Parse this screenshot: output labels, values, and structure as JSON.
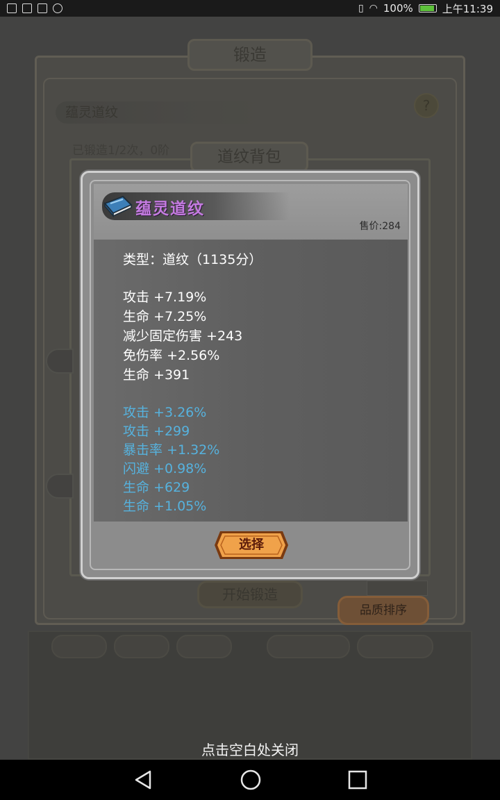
{
  "status_bar": {
    "battery": "100%",
    "battery_level": 1.0,
    "time": "上午11:39"
  },
  "background": {
    "title": "锻造",
    "item_name": "蕴灵道纹",
    "help": "?",
    "forge_count": "已锻造1/2次，0阶",
    "bag_title": "道纹背包",
    "start_forge": "开始锻造",
    "sort_quality": "品质排序"
  },
  "dialog": {
    "item_name": "蕴灵道纹",
    "price": "售价:284",
    "type_line": "类型：道纹（1135分）",
    "base_stats": [
      "攻击 +7.19%",
      "生命 +7.25%",
      "减少固定伤害 +243",
      "免伤率 +2.56%",
      "生命 +391"
    ],
    "extra_stats": [
      "攻击 +3.26%",
      "攻击 +299",
      "暴击率 +1.32%",
      "闪避 +0.98%",
      "生命 +629",
      "生命 +1.05%"
    ],
    "select_button": "选择",
    "colors": {
      "name": "#c47be0",
      "extra_stat": "#56b2de",
      "button": "#f0a24a"
    }
  },
  "close_hint": "点击空白处关闭",
  "navigation": {
    "icons": [
      "back-icon",
      "home-icon",
      "recents-icon"
    ]
  }
}
